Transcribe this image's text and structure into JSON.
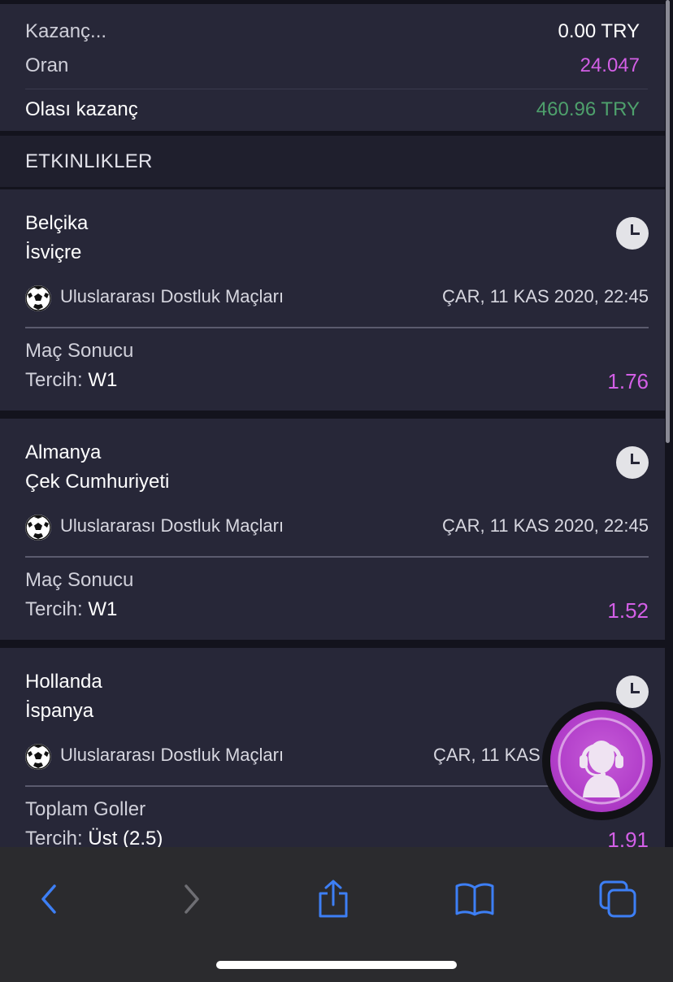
{
  "summary": {
    "stake_label": "Kazanç...",
    "stake_value": "0.00 TRY",
    "odds_label": "Oran",
    "odds_value": "24.047",
    "potential_label": "Olası kazanç",
    "potential_value": "460.96 TRY"
  },
  "section": {
    "title": "ETKINLIKLER"
  },
  "events": [
    {
      "home": "Belçika",
      "away": "İsviçre",
      "league": "Uluslararası Dostluk Maçları",
      "datetime": "ÇAR, 11 KAS 2020, 22:45",
      "market": "Maç Sonucu",
      "pick_label": "Tercih:",
      "pick_value": "W1",
      "odd": "1.76"
    },
    {
      "home": "Almanya",
      "away": "Çek Cumhuriyeti",
      "league": "Uluslararası Dostluk Maçları",
      "datetime": "ÇAR, 11 KAS 2020, 22:45",
      "market": "Maç Sonucu",
      "pick_label": "Tercih:",
      "pick_value": "W1",
      "odd": "1.52"
    },
    {
      "home": "Hollanda",
      "away": "İspanya",
      "league": "Uluslararası Dostluk Maçları",
      "datetime": "ÇAR, 11 KAS",
      "market": "Toplam Goller",
      "pick_label": "Tercih:",
      "pick_value": "Üst (2.5)",
      "odd": "1.91"
    }
  ],
  "colors": {
    "accent_purple": "#d35fe6",
    "win_green": "#4ea06c",
    "card_bg": "#272738",
    "toolbar_icon": "#3d7ff5"
  },
  "toolbar": {
    "icons": [
      "back-icon",
      "forward-icon",
      "share-icon",
      "bookmarks-icon",
      "tabs-icon"
    ]
  },
  "support": {
    "icon": "support-agent-icon"
  }
}
